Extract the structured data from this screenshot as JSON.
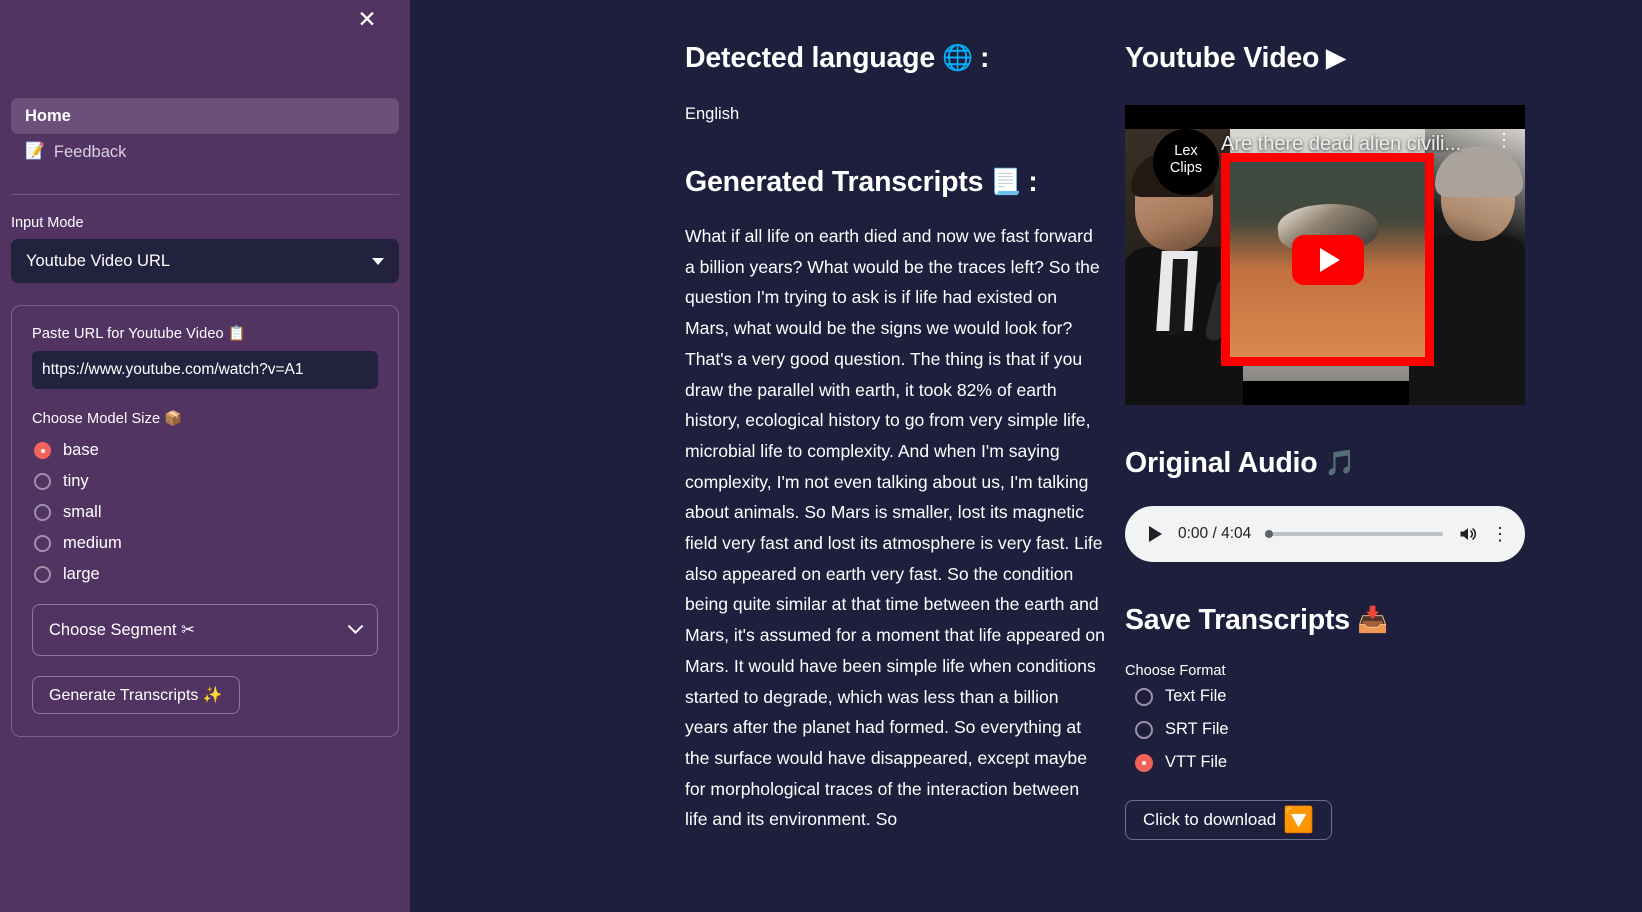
{
  "sidebar": {
    "close_icon": "close-icon",
    "nav": [
      {
        "label": "Home",
        "icon": ""
      },
      {
        "label": "Feedback",
        "icon": "📝"
      }
    ],
    "input_mode_label": "Input Mode",
    "input_mode_value": "Youtube Video URL",
    "url_field_label": "Paste URL for Youtube Video 📋",
    "url_value": "https://www.youtube.com/watch?v=A1",
    "url_placeholder": "https://www.youtube.com/watch?v=",
    "model_label": "Choose Model Size 📦",
    "model_options": [
      {
        "label": "base",
        "checked": true
      },
      {
        "label": "tiny",
        "checked": false
      },
      {
        "label": "small",
        "checked": false
      },
      {
        "label": "medium",
        "checked": false
      },
      {
        "label": "large",
        "checked": false
      }
    ],
    "segment_label": "Choose Segment ✂",
    "generate_label": "Generate Transcripts ✨"
  },
  "main": {
    "detected_language_heading": "Detected language",
    "detected_language_icon": "🌐",
    "heading_colon": ":",
    "detected_language_value": "English",
    "transcripts_heading": "Generated Transcripts",
    "transcripts_icon": "📃",
    "transcript_text": "What if all life on earth died and now we fast forward a billion years? What would be the traces left? So the question I'm trying to ask is if life had existed on Mars, what would be the signs we would look for? That's a very good question. The thing is that if you draw the parallel with earth, it took 82% of earth history, ecological history to go from very simple life, microbial life to complexity. And when I'm saying complexity, I'm not even talking about us, I'm talking about animals. So Mars is smaller, lost its magnetic field very fast and lost its atmosphere is very fast. Life also appeared on earth very fast. So the condition being quite similar at that time between the earth and Mars, it's assumed for a moment that life appeared on Mars. It would have been simple life when conditions started to degrade, which was less than a billion years after the planet had formed. So everything at the surface would have disappeared, except maybe for morphological traces of the interaction between life and its environment. So"
  },
  "video": {
    "heading": "Youtube Video",
    "heading_icon": "▶",
    "channel_line1": "Lex",
    "channel_line2": "Clips",
    "title": "Are there dead alien civili...",
    "kebab": "⋮",
    "play_icon": "youtube-play-icon"
  },
  "audio": {
    "heading": "Original Audio",
    "heading_icon": "🎵",
    "time": "0:00 / 4:04",
    "kebab": "⋮"
  },
  "save": {
    "heading": "Save Transcripts",
    "heading_icon": "📥",
    "choose_format_label": "Choose Format",
    "formats": [
      {
        "label": "Text File",
        "checked": false
      },
      {
        "label": "SRT File",
        "checked": false
      },
      {
        "label": "VTT File",
        "checked": true
      }
    ],
    "download_label": "Click to download",
    "download_icon": "🔽"
  },
  "colors": {
    "sidebar_bg": "#523463",
    "main_bg": "#1e1f3d",
    "accent_red": "#f4625c",
    "input_bg": "#22223f",
    "youtube_red": "#ff0000"
  }
}
